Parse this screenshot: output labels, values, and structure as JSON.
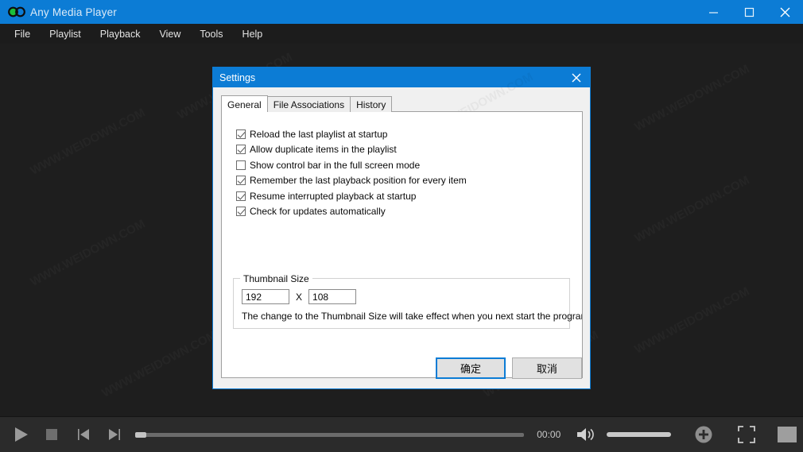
{
  "app": {
    "title": "Any Media Player",
    "logo_icon": "infinity-icon",
    "accent_color": "#0c7cd5",
    "background_color": "#1e1e1e"
  },
  "window_controls": {
    "minimize": "minimize-icon",
    "maximize": "maximize-icon",
    "close": "close-icon"
  },
  "menu": {
    "items": [
      {
        "label": "File"
      },
      {
        "label": "Playlist"
      },
      {
        "label": "Playback"
      },
      {
        "label": "View"
      },
      {
        "label": "Tools"
      },
      {
        "label": "Help"
      }
    ]
  },
  "watermark": {
    "text": "WWW.WEIDOWN.COM"
  },
  "dialog": {
    "title": "Settings",
    "close_icon": "close-icon",
    "tabs": [
      {
        "label": "General",
        "active": true
      },
      {
        "label": "File Associations",
        "active": false
      },
      {
        "label": "History",
        "active": false
      }
    ],
    "checkboxes": [
      {
        "label": "Reload the last playlist at startup",
        "checked": true
      },
      {
        "label": "Allow duplicate items in the playlist",
        "checked": true
      },
      {
        "label": "Show control bar in the full screen mode",
        "checked": false
      },
      {
        "label": "Remember the last playback position for every item",
        "checked": true
      },
      {
        "label": "Resume interrupted playback at startup",
        "checked": true
      },
      {
        "label": "Check for updates automatically",
        "checked": true
      }
    ],
    "thumbnail_group": {
      "legend": "Thumbnail Size",
      "width_value": "192",
      "separator": "X",
      "height_value": "108",
      "note": "The change to the Thumbnail Size will take effect when you next start the program."
    },
    "buttons": {
      "ok": "确定",
      "cancel": "取消"
    }
  },
  "player": {
    "play_icon": "play-icon",
    "stop_icon": "stop-icon",
    "previous_icon": "previous-track-icon",
    "next_icon": "next-track-icon",
    "seek_position_percent": 0,
    "time": "00:00",
    "volume_icon": "volume-high-icon",
    "volume_percent": 100,
    "add_icon": "plus-circle-icon",
    "fullscreen_icon": "fullscreen-icon",
    "snapshot_icon": "snapshot-icon"
  }
}
